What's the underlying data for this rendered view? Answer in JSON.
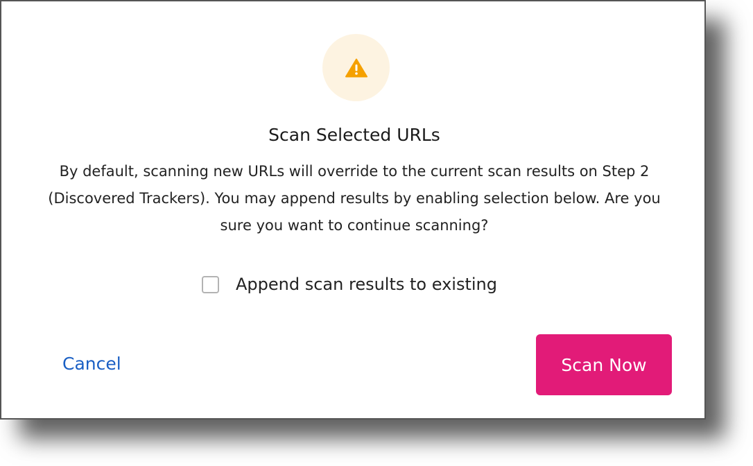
{
  "dialog": {
    "title": "Scan Selected URLs",
    "message_line1": "By default, scanning new URLs will override to the current scan results on Step 2",
    "message_line2": "(Discovered Trackers). You may append results by enabling selection below. Are you",
    "message_line3": "sure you want to continue scanning?",
    "warning_icon": "warning-triangle-icon",
    "append_checkbox": {
      "label": "Append scan results to existing",
      "checked": false
    },
    "cancel_label": "Cancel",
    "scan_now_label": "Scan Now"
  },
  "colors": {
    "accent": "#e21b78",
    "link": "#1a5fc4",
    "warning": "#f5a000",
    "warning_bg": "#fdf3e1"
  }
}
